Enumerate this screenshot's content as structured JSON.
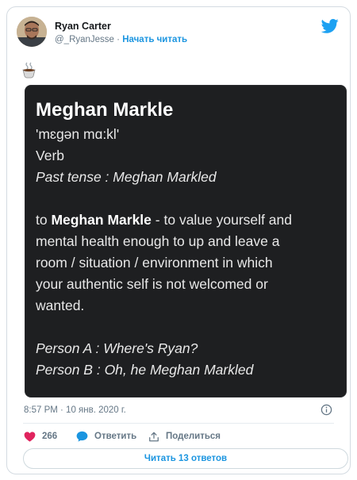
{
  "author": {
    "name": "Ryan Carter",
    "handle": "@_RyanJesse",
    "separator": "·",
    "follow_label": "Начать читать"
  },
  "tweet": {
    "text_emoji": "coffee-cup-emoji",
    "timestamp": "8:57 PM · 10 янв. 2020 г."
  },
  "image_text": {
    "word": "Meghan Markle",
    "pronunciation": "'mɛɡən mɑ:kl'",
    "part_of_speech": "Verb",
    "past_tense": "Past tense : Meghan Markled",
    "def_prefix": "to",
    "def_term": "Meghan Markle",
    "def_line1_rest": "- to value yourself and",
    "def_line2": "mental health enough to up and leave a",
    "def_line3": "room / situation / environment in which",
    "def_line4": "your authentic self is not welcomed or",
    "def_line5": "wanted.",
    "example_a": "Person A : Where's Ryan?",
    "example_b": "Person B :  Oh, he Meghan Markled"
  },
  "actions": {
    "like_count": "266",
    "reply_label": "Ответить",
    "share_label": "Поделиться"
  },
  "replies_button": "Читать 13 ответов",
  "colors": {
    "accent": "#1b95e0",
    "like": "#e0245e",
    "muted": "#657786",
    "image_bg": "#1e1f21"
  }
}
